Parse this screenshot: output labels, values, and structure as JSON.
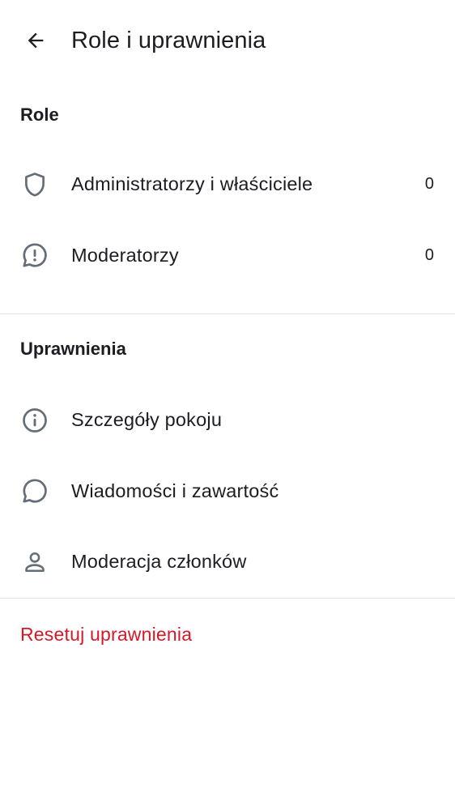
{
  "header": {
    "title": "Role i uprawnienia",
    "back_icon": "arrow-left-icon"
  },
  "roles": {
    "heading": "Role",
    "items": [
      {
        "label": "Administratorzy i właściciele",
        "count": "0",
        "icon": "shield-icon"
      },
      {
        "label": "Moderatorzy",
        "count": "0",
        "icon": "chat-alert-icon"
      }
    ]
  },
  "permissions": {
    "heading": "Uprawnienia",
    "items": [
      {
        "label": "Szczegóły pokoju",
        "icon": "info-icon"
      },
      {
        "label": "Wiadomości i zawartość",
        "icon": "chat-bubble-icon"
      },
      {
        "label": "Moderacja członków",
        "icon": "user-icon"
      }
    ]
  },
  "reset": {
    "label": "Resetuj uprawnienia"
  },
  "colors": {
    "text": "#1b1d22",
    "icon": "#656d77",
    "destructive": "#d51928",
    "divider": "#e3e5e8"
  }
}
